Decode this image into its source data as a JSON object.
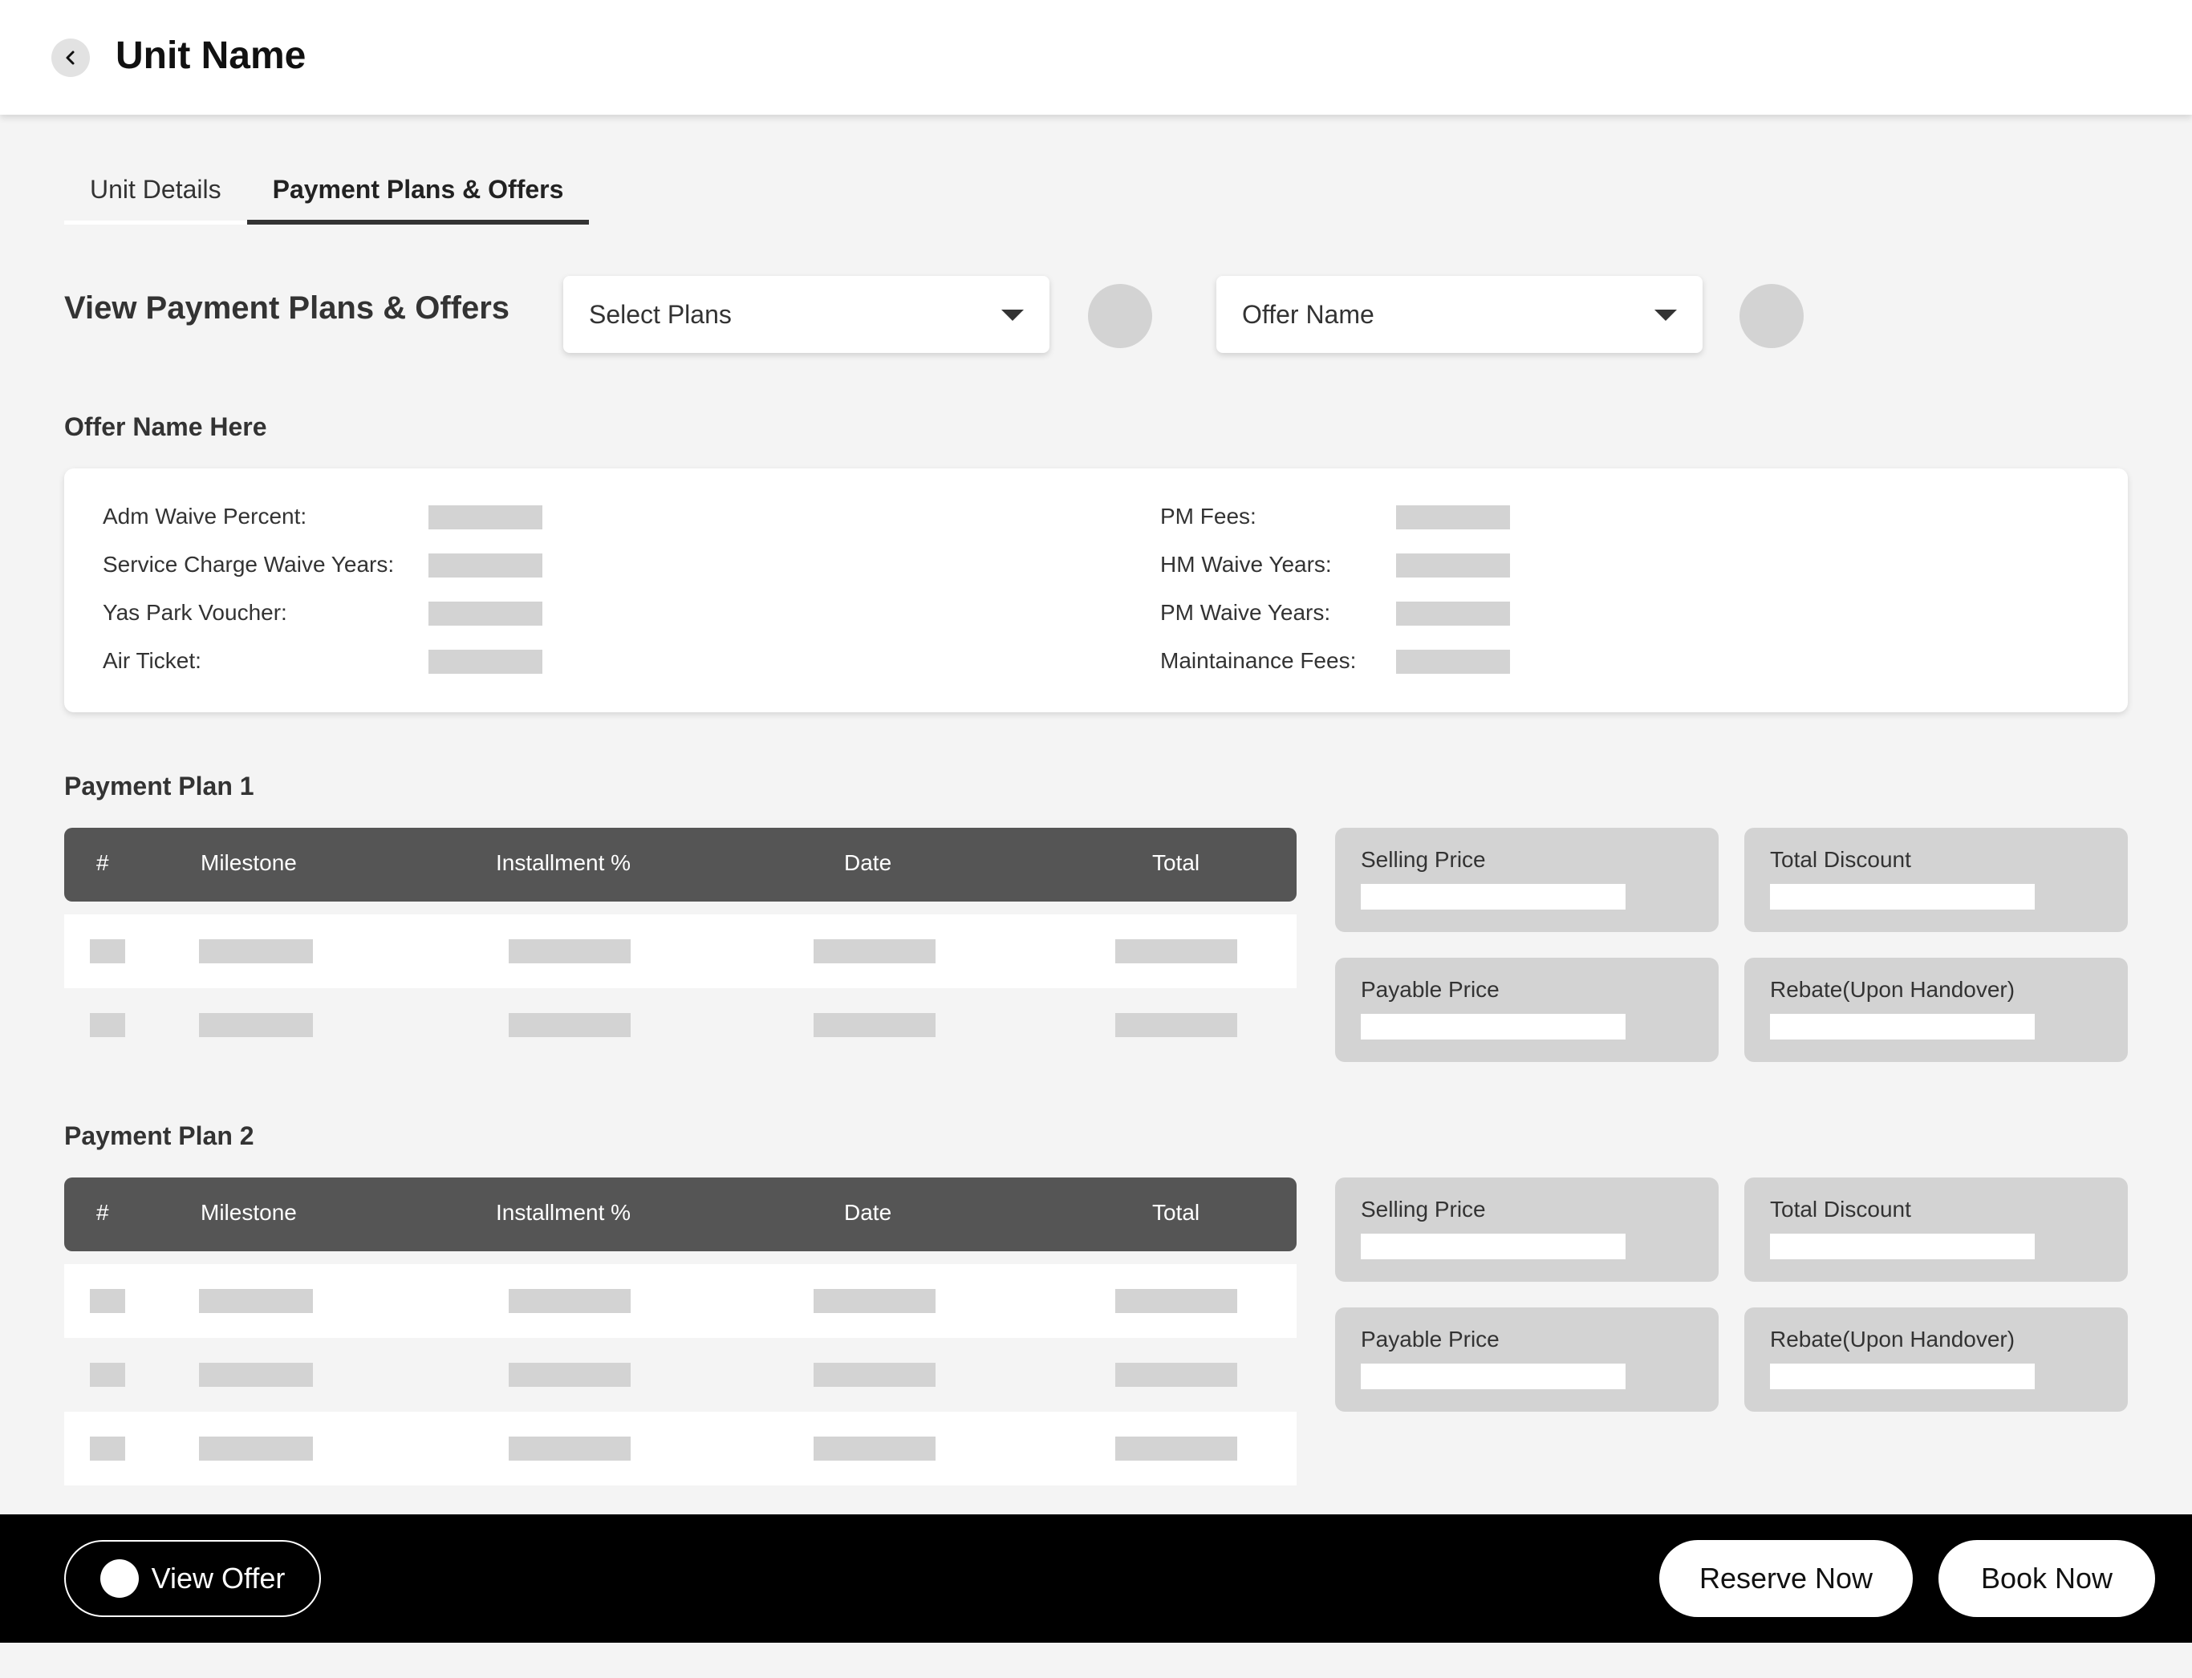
{
  "header": {
    "title": "Unit Name"
  },
  "tabs": [
    {
      "label": "Unit Details",
      "active": false
    },
    {
      "label": "Payment Plans & Offers",
      "active": true
    }
  ],
  "view_section": {
    "title": "View Payment Plans & Offers",
    "plans_select": {
      "value": "Select Plans"
    },
    "offer_select": {
      "value": "Offer Name"
    }
  },
  "offer": {
    "title": "Offer Name Here",
    "left_fields": [
      "Adm Waive Percent:",
      "Service Charge Waive Years:",
      "Yas Park Voucher:",
      "Air Ticket:"
    ],
    "right_fields": [
      "PM Fees:",
      "HM Waive Years:",
      "PM Waive Years:",
      "Maintainance Fees:"
    ]
  },
  "table_headers": [
    "#",
    "Milestone",
    "Installment %",
    "Date",
    "Total"
  ],
  "price_labels": {
    "selling": "Selling Price",
    "discount": "Total Discount",
    "payable": "Payable Price",
    "rebate": "Rebate(Upon Handover)"
  },
  "plans": [
    {
      "title": "Payment Plan 1",
      "row_count": 2
    },
    {
      "title": "Payment Plan 2",
      "row_count": 3
    }
  ],
  "footer": {
    "view_offer": "View Offer",
    "reserve": "Reserve Now",
    "book": "Book Now"
  },
  "colors": {
    "table_header_bg": "#555555",
    "placeholder": "#d3d3d3",
    "footer_bg": "#000000"
  }
}
